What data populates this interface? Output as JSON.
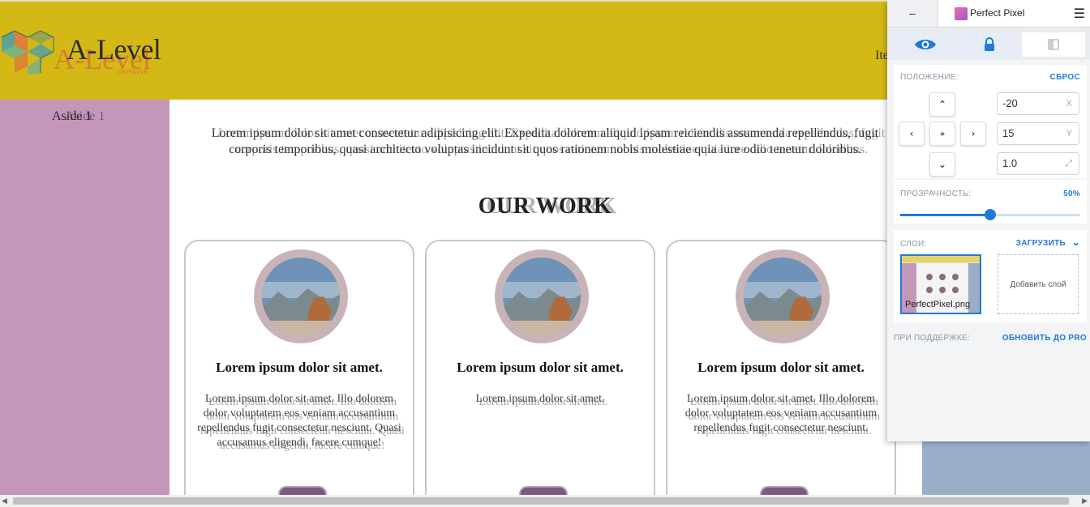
{
  "header": {
    "logo_text": "A-Level",
    "logo_sub": "UKRAINE",
    "nav_item": "Ite"
  },
  "aside": {
    "title": "Aside 1"
  },
  "main": {
    "intro": "Lorem ipsum dolor sit amet consectetur adipisicing elit. Expedita dolorem aliquid ipsam reiciendis assumenda repellendus, fugit corporis temporibus, quasi architecto voluptas incidunt sit quos rationem nobis molestiae quia iure odio tenetur doloribus.",
    "title": "OUR WORK",
    "cards": [
      {
        "title": "Lorem ipsum dolor sit amet.",
        "text": "Lorem ipsum dolor sit amet. Illo dolorem dolor voluptatem eos veniam accusantium repellendus fugit consectetur nesciunt. Quasi accusamus eligendi, facere cumque!"
      },
      {
        "title": "Lorem ipsum dolor sit amet.",
        "text": "Lorem ipsum dolor sit amet."
      },
      {
        "title": "Lorem ipsum dolor sit amet.",
        "text": "Lorem ipsum dolor sit amet. Illo dolorem dolor voluptatem eos veniam accusantium repellendus fugit consectetur nesciunt."
      }
    ]
  },
  "panel": {
    "minimize": "–",
    "title": "Perfect Pixel",
    "position_label": "ПОЛОЖЕНИЕ:",
    "reset_label": "СБРОС",
    "x_value": "-20",
    "x_suffix": "X",
    "y_value": "15",
    "y_suffix": "Y",
    "scale_value": "1.0",
    "scale_suffix": "⤢",
    "opacity_label": "ПРОЗРАЧНОСТЬ:",
    "opacity_value": "50%",
    "opacity_fraction": 0.5,
    "layers_label": "СЛОИ:",
    "upload_label": "ЗАГРУЗИТЬ",
    "layer_name": "PerfectPixel.png",
    "add_layer": "Добавить слой",
    "support_label": "ПРИ ПОДДЕРЖКЕ:",
    "upgrade_label": "ОБНОВИТЬ ДО PRO"
  },
  "colors": {
    "header_bg": "#d4b816",
    "aside_bg": "#c497ba",
    "accent": "#1e7ad6"
  }
}
